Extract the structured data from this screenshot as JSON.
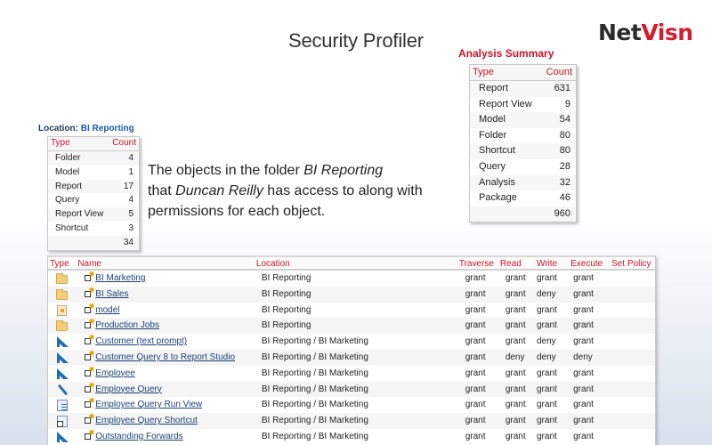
{
  "page": {
    "title": "Security Profiler",
    "logo": {
      "part1": "Net",
      "part2": "Visn",
      "accent_color": "#d71a2c"
    }
  },
  "analysis_summary": {
    "title": "Analysis Summary",
    "headers": {
      "type": "Type",
      "count": "Count"
    },
    "rows": [
      {
        "type": "Report",
        "count": "631"
      },
      {
        "type": "Report View",
        "count": "9"
      },
      {
        "type": "Model",
        "count": "54"
      },
      {
        "type": "Folder",
        "count": "80"
      },
      {
        "type": "Shortcut",
        "count": "80"
      },
      {
        "type": "Query",
        "count": "28"
      },
      {
        "type": "Analysis",
        "count": "32"
      },
      {
        "type": "Package",
        "count": "46"
      }
    ],
    "total": "960"
  },
  "location": {
    "label": "Location:",
    "value": "BI Reporting",
    "headers": {
      "type": "Type",
      "count": "Count"
    },
    "rows": [
      {
        "type": "Folder",
        "count": "4"
      },
      {
        "type": "Model",
        "count": "1"
      },
      {
        "type": "Report",
        "count": "17"
      },
      {
        "type": "Query",
        "count": "4"
      },
      {
        "type": "Report View",
        "count": "5"
      },
      {
        "type": "Shortcut",
        "count": "3"
      }
    ],
    "total": "34"
  },
  "description": {
    "part1": "The objects in the folder ",
    "folder": "BI Reporting",
    "part2": " that ",
    "user": "Duncan Reilly",
    "part3": " has access to along with permissions for each object."
  },
  "objects_table": {
    "headers": {
      "type": "Type",
      "name": "Name",
      "location": "Location",
      "traverse": "Traverse",
      "read": "Read",
      "write": "Write",
      "execute": "Execute",
      "set_policy": "Set Policy"
    },
    "rows": [
      {
        "icon": "folder-icon",
        "name": "BI Marketing",
        "location": "BI Reporting",
        "traverse": "grant",
        "read": "grant",
        "write": "grant",
        "execute": "grant",
        "set_policy": ""
      },
      {
        "icon": "folder-icon",
        "name": "BI Sales",
        "location": "BI Reporting",
        "traverse": "grant",
        "read": "grant",
        "write": "deny",
        "execute": "grant",
        "set_policy": ""
      },
      {
        "icon": "model-icon",
        "name": "model",
        "location": "BI Reporting",
        "traverse": "grant",
        "read": "grant",
        "write": "grant",
        "execute": "grant",
        "set_policy": ""
      },
      {
        "icon": "folder-icon",
        "name": "Production Jobs",
        "location": "BI Reporting",
        "traverse": "grant",
        "read": "grant",
        "write": "grant",
        "execute": "grant",
        "set_policy": ""
      },
      {
        "icon": "report-icon",
        "name": "Customer (text prompt)",
        "location": "BI Reporting / BI Marketing",
        "traverse": "grant",
        "read": "grant",
        "write": "deny",
        "execute": "grant",
        "set_policy": ""
      },
      {
        "icon": "report-icon",
        "name": "Customer Query 8 to Report Studio",
        "location": "BI Reporting / BI Marketing",
        "traverse": "grant",
        "read": "deny",
        "write": "deny",
        "execute": "deny",
        "set_policy": ""
      },
      {
        "icon": "report-icon",
        "name": "Employee",
        "location": "BI Reporting / BI Marketing",
        "traverse": "grant",
        "read": "grant",
        "write": "grant",
        "execute": "grant",
        "set_policy": ""
      },
      {
        "icon": "query-icon",
        "name": "Employee Query",
        "location": "BI Reporting / BI Marketing",
        "traverse": "grant",
        "read": "grant",
        "write": "grant",
        "execute": "grant",
        "set_policy": ""
      },
      {
        "icon": "report-view-icon",
        "name": "Employee Query Run View",
        "location": "BI Reporting / BI Marketing",
        "traverse": "grant",
        "read": "grant",
        "write": "grant",
        "execute": "grant",
        "set_policy": ""
      },
      {
        "icon": "shortcut-icon",
        "name": "Employee Query Shortcut",
        "location": "BI Reporting / BI Marketing",
        "traverse": "grant",
        "read": "grant",
        "write": "grant",
        "execute": "grant",
        "set_policy": ""
      },
      {
        "icon": "report-icon",
        "name": "Outstanding Forwards",
        "location": "BI Reporting / BI Marketing",
        "traverse": "grant",
        "read": "grant",
        "write": "grant",
        "execute": "grant",
        "set_policy": ""
      }
    ]
  }
}
